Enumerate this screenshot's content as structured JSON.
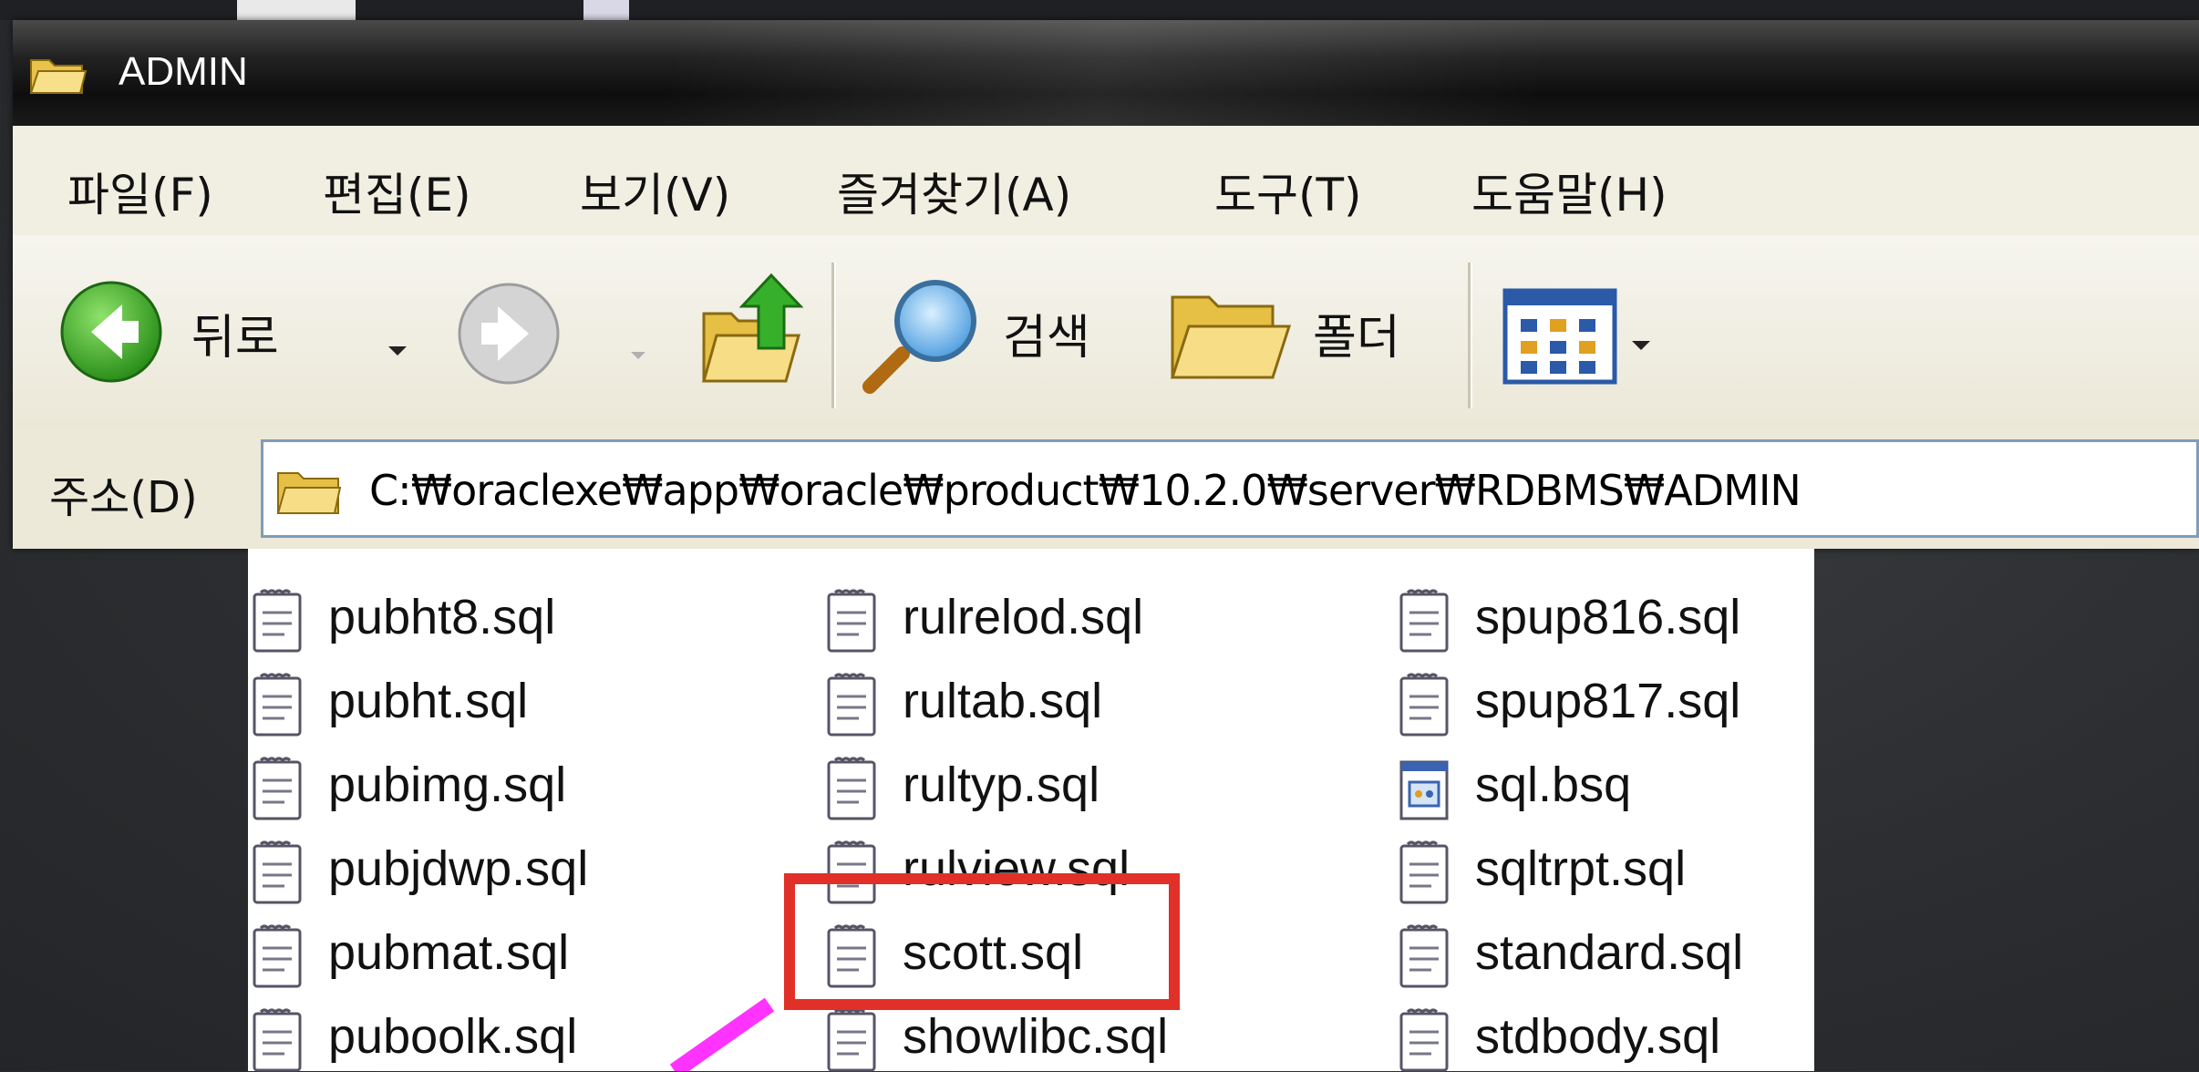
{
  "window": {
    "title": "ADMIN",
    "title_icon": "folder-open-icon"
  },
  "menu": [
    {
      "label": "파일(F)"
    },
    {
      "label": "편집(E)"
    },
    {
      "label": "보기(V)"
    },
    {
      "label": "즐겨찾기(A)"
    },
    {
      "label": "도구(T)"
    },
    {
      "label": "도움말(H)"
    }
  ],
  "toolbar": {
    "back_label": "뒤로",
    "search_label": "검색",
    "folders_label": "폴더"
  },
  "address": {
    "label": "주소(D)",
    "path": "C:₩oraclexe₩app₩oracle₩product₩10.2.0₩server₩RDBMS₩ADMIN"
  },
  "files": {
    "col1": [
      "pubht8.sql",
      "pubht.sql",
      "pubimg.sql",
      "pubjdwp.sql",
      "pubmat.sql",
      "puboolk.sql"
    ],
    "col2": [
      "rulrelod.sql",
      "rultab.sql",
      "rultyp.sql",
      "rulview.sql",
      "scott.sql",
      "showlibc.sql"
    ],
    "col3": [
      "spup816.sql",
      "spup817.sql",
      "sql.bsq",
      "sqltrpt.sql",
      "standard.sql",
      "stdbody.sql"
    ]
  },
  "colors": {
    "highlight": "#e03028",
    "pointer": "#ff33ff",
    "address_border": "#7f9db9"
  }
}
